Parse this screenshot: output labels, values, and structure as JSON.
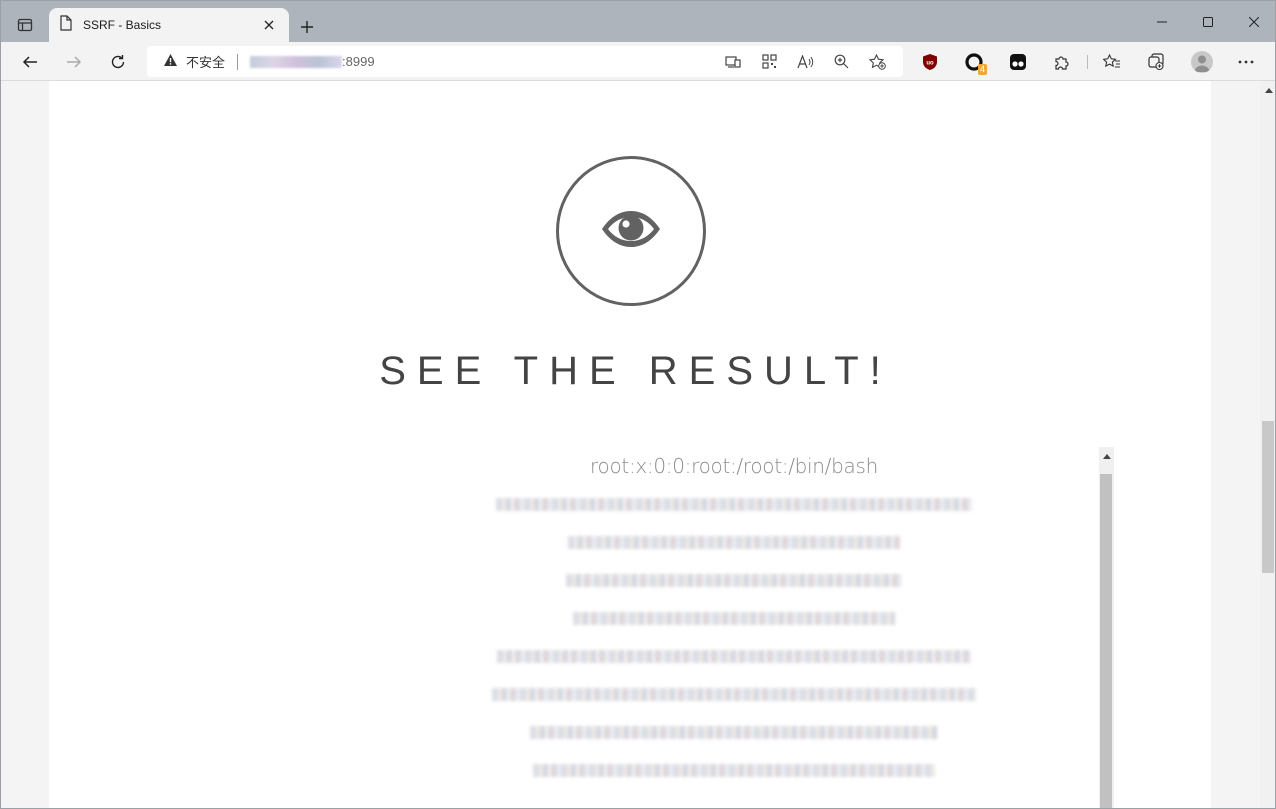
{
  "browser": {
    "tab_title": "SSRF - Basics",
    "security_label": "不安全",
    "url_port": ":8999",
    "extension_badge": "4"
  },
  "icons": {
    "tab_actions": "tab-actions-icon",
    "page": "page-icon",
    "close": "close-icon",
    "new_tab": "plus-icon",
    "minimize": "minimize-icon",
    "maximize": "maximize-icon",
    "window_close": "window-close-icon",
    "back": "back-arrow-icon",
    "forward": "forward-arrow-icon",
    "refresh": "refresh-icon",
    "warning": "warning-icon",
    "result": "eye-icon"
  },
  "page": {
    "heading": "SEE THE RESULT!",
    "result_first_line": "root:x:0:0:root:/root:/bin/bash",
    "result_last_line": "games:x:5:60:games:/usr/games:/usr/sbin/nologin"
  },
  "colors": {
    "heading": "#444444",
    "eye": "#626262",
    "page_bg": "#ffffff",
    "chrome_bg": "#f3f3f3",
    "tabstrip_bg": "#aeb4bb"
  }
}
